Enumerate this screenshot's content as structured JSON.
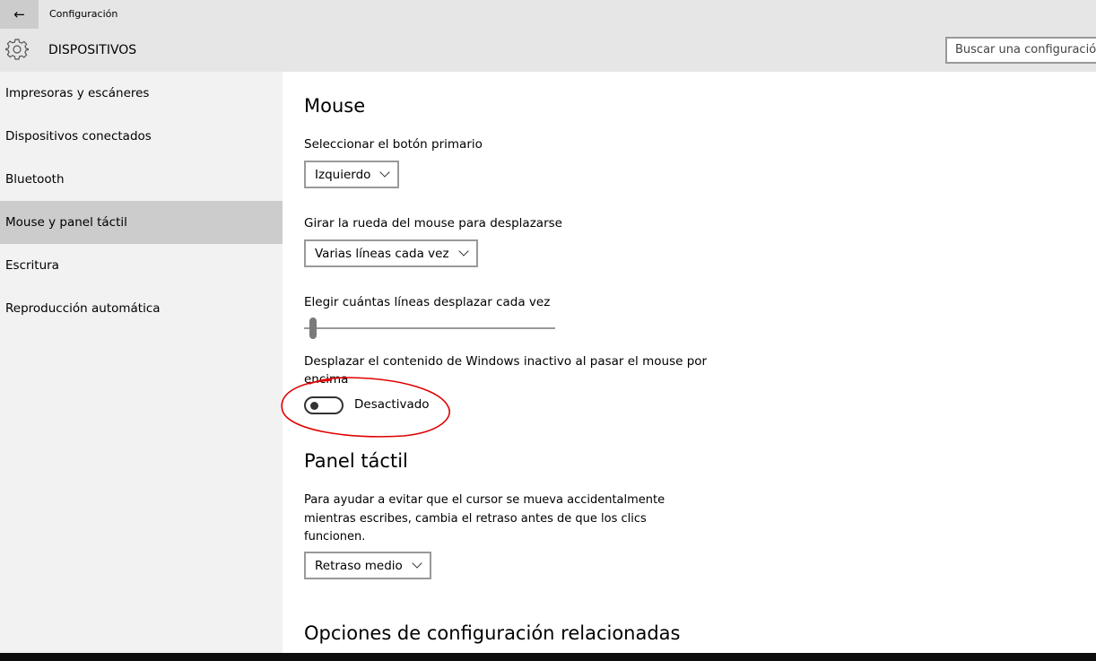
{
  "window": {
    "title": "Configuración",
    "back_icon": "arrow-left-icon"
  },
  "header": {
    "section": "DISPOSITIVOS",
    "icon": "gear-icon",
    "search_placeholder": "Buscar una configuración"
  },
  "sidebar": {
    "items": [
      {
        "label": "Impresoras y escáneres"
      },
      {
        "label": "Dispositivos conectados"
      },
      {
        "label": "Bluetooth"
      },
      {
        "label": "Mouse y panel táctil",
        "selected": true
      },
      {
        "label": "Escritura"
      },
      {
        "label": "Reproducción automática"
      }
    ]
  },
  "main": {
    "mouse_heading": "Mouse",
    "primary_label": "Seleccionar el botón primario",
    "primary_value": "Izquierdo",
    "wheel_label": "Girar la rueda del mouse para desplazarse",
    "wheel_value": "Varias líneas cada vez",
    "lines_label": "Elegir cuántas líneas desplazar cada vez",
    "lines_slider_value_fraction": 0.02,
    "inactive_label": "Desplazar el contenido de Windows inactivo al pasar el mouse por encima",
    "inactive_state": "Desactivado",
    "inactive_on": false,
    "annotation_color": "#e00000",
    "touchpad_heading": "Panel táctil",
    "touchpad_desc": "Para ayudar a evitar que el cursor se mueva accidentalmente mientras escribes, cambia el retraso antes de que los clics funcionen.",
    "touchpad_value": "Retraso medio",
    "related_heading": "Opciones de configuración relacionadas"
  }
}
